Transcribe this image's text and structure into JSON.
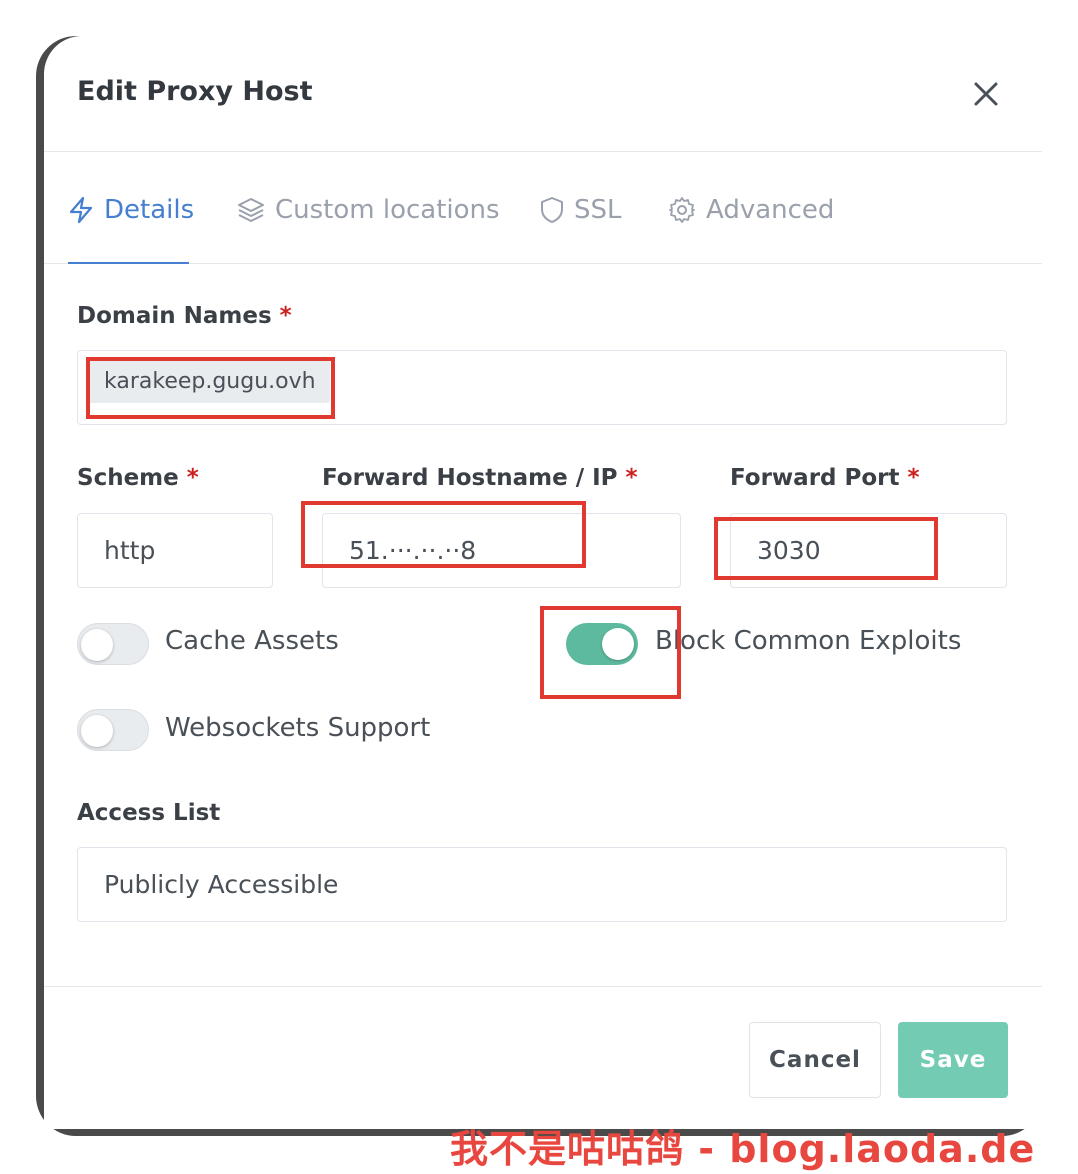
{
  "modal": {
    "title": "Edit Proxy Host",
    "close_icon": "close-icon"
  },
  "tabs": [
    {
      "label": "Details",
      "icon": "bolt-icon",
      "active": true
    },
    {
      "label": "Custom locations",
      "icon": "layers-icon",
      "active": false
    },
    {
      "label": "SSL",
      "icon": "shield-icon",
      "active": false
    },
    {
      "label": "Advanced",
      "icon": "gear-icon",
      "active": false
    }
  ],
  "form": {
    "domain_names": {
      "label": "Domain Names",
      "required": "*",
      "values": [
        "karakeep.gugu.ovh"
      ]
    },
    "scheme": {
      "label": "Scheme",
      "required": "*",
      "value": "http"
    },
    "forward_host": {
      "label": "Forward Hostname / IP",
      "required": "*",
      "value": "51.···.··.··8"
    },
    "forward_port": {
      "label": "Forward Port",
      "required": "*",
      "value": "3030"
    },
    "cache_assets": {
      "label": "Cache Assets",
      "enabled": false
    },
    "block_exploits": {
      "label": "Block Common Exploits",
      "enabled": true
    },
    "websockets": {
      "label": "Websockets Support",
      "enabled": false
    },
    "access_list": {
      "label": "Access List",
      "value": "Publicly Accessible"
    }
  },
  "footer": {
    "cancel_label": "Cancel",
    "save_label": "Save"
  },
  "colors": {
    "accent": "#467fcf",
    "toggle_on": "#5eba9f",
    "save_button": "#73cbb3",
    "highlight": "#e03a30",
    "required": "#cd201f"
  },
  "watermark": "我不是咕咕鸽 - blog.laoda.de"
}
